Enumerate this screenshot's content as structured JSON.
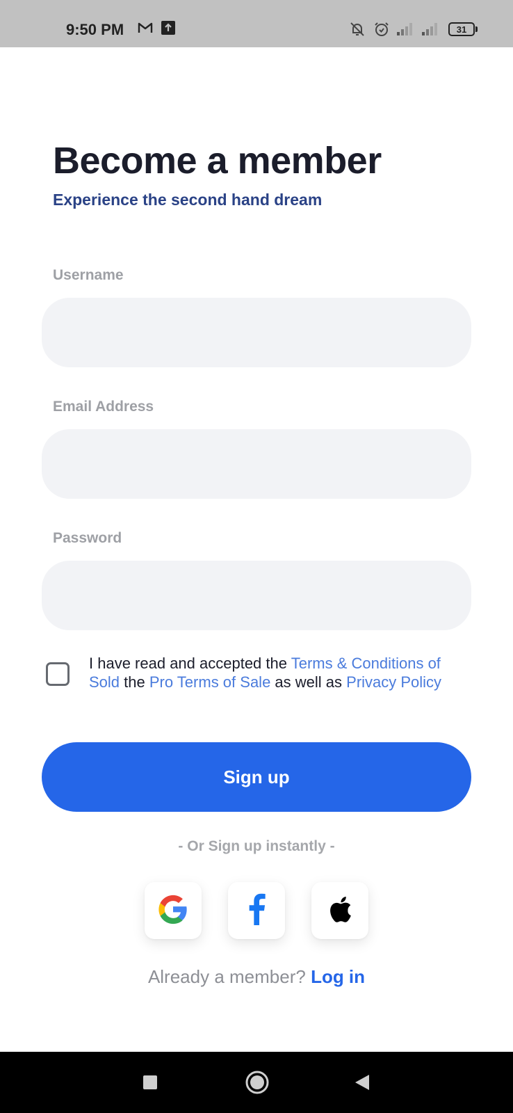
{
  "status_bar": {
    "time": "9:50 PM",
    "battery": "31",
    "icons": [
      "gmail-icon",
      "upload-icon",
      "bell-off-icon",
      "alarm-icon",
      "signal-icon",
      "signal-icon",
      "battery-icon"
    ]
  },
  "header": {
    "title": "Become a member",
    "subtitle": "Experience the second hand dream"
  },
  "form": {
    "username_label": "Username",
    "username_value": "",
    "email_label": "Email Address",
    "email_value": "",
    "password_label": "Password",
    "password_value": ""
  },
  "terms": {
    "checked": false,
    "text_1": "I have read and accepted the ",
    "link_1": "Terms & Conditions of Sold",
    "text_2": " the ",
    "link_2": "Pro Terms of Sale",
    "text_3": " as well as ",
    "link_3": "Privacy Policy"
  },
  "signup_button": "Sign up",
  "social": {
    "divider_text": "- Or Sign up instantly -",
    "providers": [
      "google-icon",
      "facebook-icon",
      "apple-icon"
    ]
  },
  "login": {
    "prompt": "Already a member?",
    "link": "Log in"
  },
  "colors": {
    "accent": "#2566e8",
    "title": "#1b1d2b",
    "subtitle": "#2a4286",
    "label": "#9ea0a5",
    "input_bg": "#f2f3f6",
    "link": "#4a7bdc",
    "status_bar": "#c1c1c1",
    "nav_bar": "#000000"
  },
  "nav_bar": {
    "buttons": [
      "recent-apps-icon",
      "home-icon",
      "back-icon"
    ]
  }
}
